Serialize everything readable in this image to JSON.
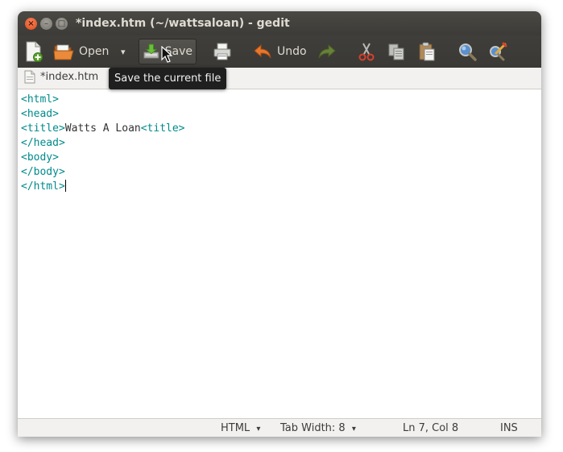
{
  "window": {
    "title": "*index.htm (~/wattsaloan) - gedit",
    "close_glyph": "×",
    "min_glyph": "–",
    "max_glyph": "□"
  },
  "toolbar": {
    "open_label": "Open",
    "dropdown_glyph": "▾",
    "save_label": "Save",
    "undo_label": "Undo"
  },
  "tooltip": {
    "text": "Save the current file"
  },
  "tab": {
    "label": "*index.htm"
  },
  "editor": {
    "lines": [
      {
        "tag_before": "<html>",
        "text": "",
        "tag_after": ""
      },
      {
        "tag_before": "<head>",
        "text": "",
        "tag_after": ""
      },
      {
        "tag_before": "<title>",
        "text": "Watts A Loan",
        "tag_after": "<title>"
      },
      {
        "tag_before": "</head>",
        "text": "",
        "tag_after": ""
      },
      {
        "tag_before": "<body>",
        "text": "",
        "tag_after": ""
      },
      {
        "tag_before": "</body>",
        "text": "",
        "tag_after": ""
      },
      {
        "tag_before": "</html>",
        "text": "",
        "tag_after": ""
      }
    ],
    "tag_color": "#008a8c"
  },
  "statusbar": {
    "language": "HTML",
    "tab_width": "Tab Width: 8",
    "dropdown_glyph": "▾",
    "position": "Ln 7, Col 8",
    "mode": "INS"
  },
  "colors": {
    "titlebar": "#3c3b37",
    "close_button": "#df4a16",
    "chrome": "#f2f1ef"
  }
}
